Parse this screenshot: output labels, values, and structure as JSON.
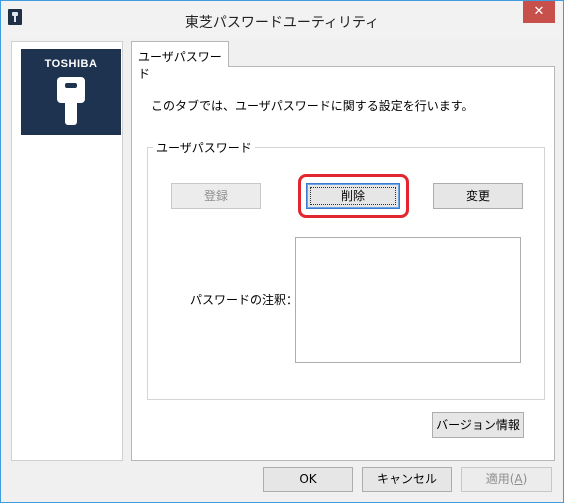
{
  "window": {
    "title": "東芝パスワードユーティリティ",
    "close_glyph": "✕"
  },
  "sidebar": {
    "logo_text": "TOSHIBA"
  },
  "tab": {
    "label": "ユーザパスワード"
  },
  "main": {
    "description": "このタブでは、ユーザパスワードに関する設定を行います。",
    "group_label": "ユーザパスワード",
    "buttons": {
      "register": "登録",
      "delete": "削除",
      "change": "変更"
    },
    "note_label": "パスワードの注釈：",
    "note_value": "",
    "version_button": "バージョン情報"
  },
  "footer": {
    "ok": "OK",
    "cancel": "キャンセル",
    "apply_prefix": "適用(",
    "apply_key": "A",
    "apply_suffix": ")"
  },
  "colors": {
    "highlight": "#e3262d",
    "logo_bg": "#1e3350",
    "close_bg": "#c7504b"
  }
}
